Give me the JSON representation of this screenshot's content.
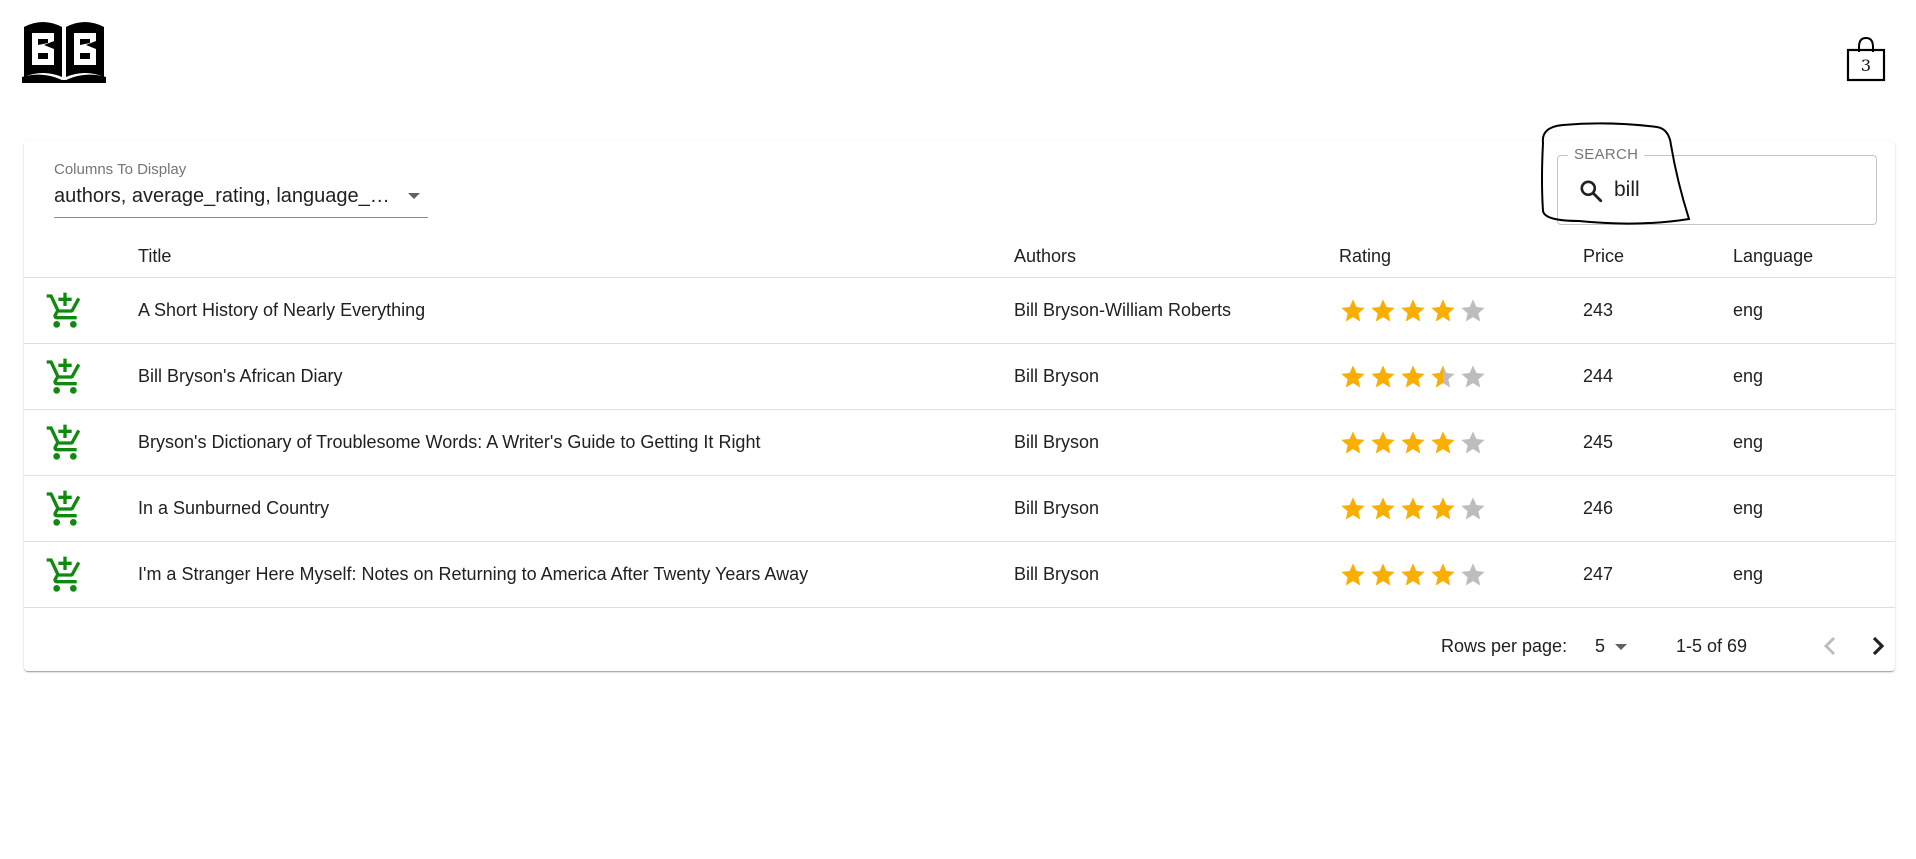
{
  "cart_count": "3",
  "columns_picker": {
    "label": "Columns To Display",
    "value": "authors, average_rating, language_code, price"
  },
  "search": {
    "legend": "SEARCH",
    "value": "bill"
  },
  "table": {
    "headers": {
      "title": "Title",
      "authors": "Authors",
      "rating": "Rating",
      "price": "Price",
      "language": "Language"
    },
    "rows": [
      {
        "title": "A Short History of Nearly Everything",
        "authors": "Bill Bryson-William Roberts",
        "rating": 4,
        "price": "243",
        "language": "eng"
      },
      {
        "title": "Bill Bryson's African Diary",
        "authors": "Bill Bryson",
        "rating": 3.5,
        "price": "244",
        "language": "eng"
      },
      {
        "title": "Bryson's Dictionary of Troublesome Words: A Writer's Guide to Getting It Right",
        "authors": "Bill Bryson",
        "rating": 4,
        "price": "245",
        "language": "eng"
      },
      {
        "title": "In a Sunburned Country",
        "authors": "Bill Bryson",
        "rating": 4,
        "price": "246",
        "language": "eng"
      },
      {
        "title": "I'm a Stranger Here Myself: Notes on Returning to America After Twenty Years Away",
        "authors": "Bill Bryson",
        "rating": 4,
        "price": "247",
        "language": "eng"
      }
    ]
  },
  "pagination": {
    "rows_per_page_label": "Rows per page:",
    "rows_per_page": "5",
    "range": "1-5 of 69"
  },
  "colors": {
    "cart_green": "#0f8a0f",
    "star_filled": "#faaf00",
    "star_empty": "#bdbdbd"
  },
  "icons": [
    "open-book-logo-icon",
    "shopping-bag-icon",
    "search-icon",
    "add-shopping-cart-icon",
    "star-icon",
    "chevron-left-icon",
    "chevron-right-icon"
  ]
}
